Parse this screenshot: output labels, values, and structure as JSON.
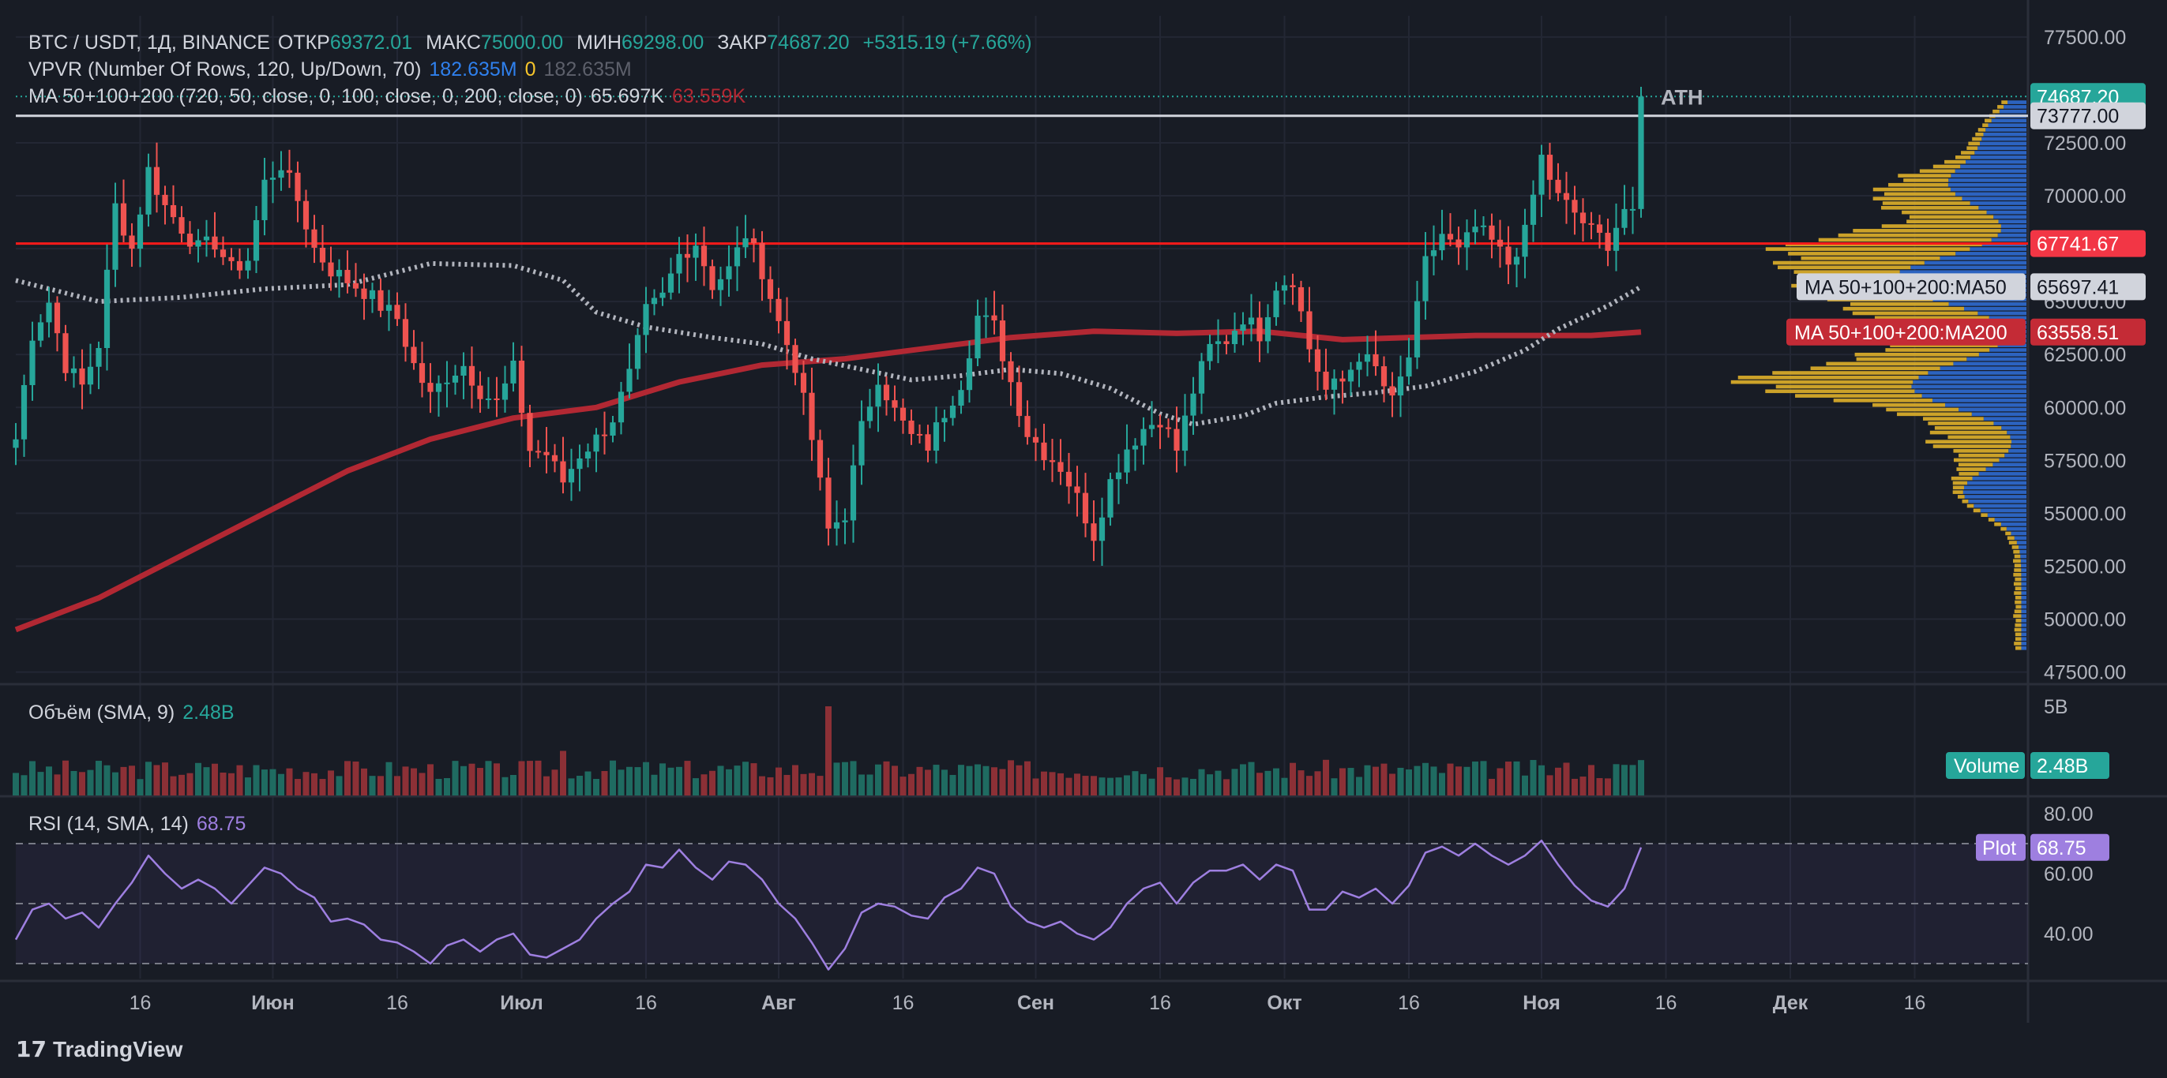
{
  "header": {
    "symbol": "BTC / USDT, 1Д, BINANCE",
    "open_label": "ОТКР",
    "open": "69372.01",
    "high_label": "МАКС",
    "high": "75000.00",
    "low_label": "МИН",
    "low": "69298.00",
    "close_label": "ЗАКР",
    "close": "74687.20",
    "change": "+5315.19 (+7.66%)"
  },
  "vpvr": {
    "label": "VPVR (Number Of Rows, 120, Up/Down, 70)",
    "up": "182.635M",
    "down": "0",
    "total": "182.635M"
  },
  "ma": {
    "label": "MA 50+100+200 (720, 50, close, 0, 100, close, 0, 200, close, 0)",
    "ma50": "65.697K",
    "ma200": "63.559K"
  },
  "volume_legend": {
    "label": "Объём (SMA, 9)",
    "value": "2.48B"
  },
  "rsi_legend": {
    "label": "RSI (14, SMA, 14)",
    "value": "68.75"
  },
  "colors": {
    "up": "#26a69a",
    "down": "#ef5350",
    "ma50": "#b2b5be",
    "ma200": "#b22833",
    "resistance": "#ff1a1a",
    "ath_line": "#d1d4dc",
    "rsi": "#9e7fe0",
    "vp_up": "#2f6bd1",
    "vp_down": "#e0b12a"
  },
  "branding": {
    "name": "TradingView"
  },
  "chart_data": [
    {
      "type": "candlestick",
      "title": "BTC / USDT, 1Д, BINANCE",
      "ylim": [
        47000,
        78500
      ],
      "y_ticks": [
        "77500.00",
        "72500.00",
        "70000.00",
        "67500.00",
        "65000.00",
        "62500.00",
        "60000.00",
        "57500.00",
        "55000.00",
        "52500.00",
        "50000.00",
        "47500.00"
      ],
      "x_ticks": [
        {
          "label": "16",
          "day": 15
        },
        {
          "label": "Июн",
          "day": 31
        },
        {
          "label": "16",
          "day": 46
        },
        {
          "label": "Июл",
          "day": 61
        },
        {
          "label": "16",
          "day": 76
        },
        {
          "label": "Авг",
          "day": 92
        },
        {
          "label": "16",
          "day": 107
        },
        {
          "label": "Сен",
          "day": 123
        },
        {
          "label": "16",
          "day": 138
        },
        {
          "label": "Окт",
          "day": 153
        },
        {
          "label": "16",
          "day": 168
        },
        {
          "label": "Ноя",
          "day": 184
        },
        {
          "label": "16",
          "day": 199
        },
        {
          "label": "Дек",
          "day": 214
        },
        {
          "label": "16",
          "day": 229
        }
      ],
      "close_points": [
        [
          0,
          58500
        ],
        [
          2,
          63500
        ],
        [
          4,
          65000
        ],
        [
          6,
          62000
        ],
        [
          8,
          61000
        ],
        [
          10,
          63000
        ],
        [
          12,
          69500
        ],
        [
          14,
          67500
        ],
        [
          16,
          71200
        ],
        [
          18,
          69500
        ],
        [
          20,
          68500
        ],
        [
          22,
          67500
        ],
        [
          24,
          67800
        ],
        [
          26,
          66500
        ],
        [
          28,
          67000
        ],
        [
          30,
          70600
        ],
        [
          32,
          71500
        ],
        [
          34,
          69800
        ],
        [
          36,
          67500
        ],
        [
          38,
          66500
        ],
        [
          40,
          66000
        ],
        [
          42,
          65500
        ],
        [
          44,
          64800
        ],
        [
          46,
          64200
        ],
        [
          48,
          62000
        ],
        [
          50,
          60500
        ],
        [
          52,
          61500
        ],
        [
          54,
          62000
        ],
        [
          56,
          60800
        ],
        [
          58,
          60200
        ],
        [
          60,
          61800
        ],
        [
          62,
          58000
        ],
        [
          64,
          57800
        ],
        [
          66,
          56500
        ],
        [
          68,
          57800
        ],
        [
          70,
          58500
        ],
        [
          72,
          59500
        ],
        [
          74,
          61500
        ],
        [
          76,
          64500
        ],
        [
          78,
          65200
        ],
        [
          80,
          67200
        ],
        [
          82,
          67800
        ],
        [
          84,
          65800
        ],
        [
          86,
          66500
        ],
        [
          88,
          68200
        ],
        [
          90,
          66500
        ],
        [
          92,
          64000
        ],
        [
          94,
          62000
        ],
        [
          96,
          58500
        ],
        [
          98,
          54200
        ],
        [
          100,
          55000
        ],
        [
          102,
          59000
        ],
        [
          104,
          61500
        ],
        [
          106,
          59800
        ],
        [
          108,
          58600
        ],
        [
          110,
          58200
        ],
        [
          112,
          59800
        ],
        [
          114,
          61200
        ],
        [
          116,
          64300
        ],
        [
          118,
          63800
        ],
        [
          120,
          61200
        ],
        [
          122,
          58800
        ],
        [
          124,
          57900
        ],
        [
          126,
          57200
        ],
        [
          128,
          55700
        ],
        [
          130,
          54000
        ],
        [
          132,
          56500
        ],
        [
          134,
          58100
        ],
        [
          136,
          59000
        ],
        [
          138,
          59500
        ],
        [
          140,
          58000
        ],
        [
          142,
          60800
        ],
        [
          144,
          62800
        ],
        [
          146,
          63200
        ],
        [
          148,
          64300
        ],
        [
          150,
          63500
        ],
        [
          152,
          65800
        ],
        [
          154,
          66100
        ],
        [
          156,
          62800
        ],
        [
          158,
          60800
        ],
        [
          160,
          61200
        ],
        [
          162,
          62500
        ],
        [
          164,
          61800
        ],
        [
          166,
          60200
        ],
        [
          168,
          62400
        ],
        [
          170,
          66800
        ],
        [
          172,
          68200
        ],
        [
          174,
          67300
        ],
        [
          176,
          68500
        ],
        [
          178,
          67800
        ],
        [
          180,
          66800
        ],
        [
          182,
          68200
        ],
        [
          184,
          71800
        ],
        [
          186,
          69900
        ],
        [
          188,
          69200
        ],
        [
          190,
          68300
        ],
        [
          192,
          67800
        ],
        [
          194,
          69400
        ],
        [
          196,
          74690
        ]
      ],
      "last_close": 74687.2,
      "resistance": 67741.67,
      "ath_level": 73777.0,
      "ath_label": "ATH",
      "ma50_points": [
        [
          0,
          66000
        ],
        [
          10,
          65000
        ],
        [
          20,
          65200
        ],
        [
          30,
          65600
        ],
        [
          40,
          65800
        ],
        [
          50,
          66800
        ],
        [
          60,
          66700
        ],
        [
          66,
          66000
        ],
        [
          70,
          64500
        ],
        [
          76,
          63800
        ],
        [
          84,
          63300
        ],
        [
          90,
          63000
        ],
        [
          96,
          62300
        ],
        [
          102,
          61800
        ],
        [
          108,
          61300
        ],
        [
          114,
          61500
        ],
        [
          120,
          61800
        ],
        [
          126,
          61600
        ],
        [
          132,
          60900
        ],
        [
          138,
          59700
        ],
        [
          142,
          59200
        ],
        [
          148,
          59600
        ],
        [
          152,
          60200
        ],
        [
          158,
          60500
        ],
        [
          164,
          60700
        ],
        [
          170,
          61000
        ],
        [
          176,
          61700
        ],
        [
          182,
          62700
        ],
        [
          186,
          63700
        ],
        [
          192,
          64800
        ],
        [
          196,
          65697.41
        ]
      ],
      "ma50_value": 65697.41,
      "ma50_label": "MA 50+100+200:MA50",
      "ma200_points": [
        [
          0,
          49500
        ],
        [
          10,
          51000
        ],
        [
          20,
          53000
        ],
        [
          30,
          55000
        ],
        [
          40,
          57000
        ],
        [
          50,
          58500
        ],
        [
          60,
          59500
        ],
        [
          70,
          60000
        ],
        [
          80,
          61200
        ],
        [
          90,
          62000
        ],
        [
          100,
          62300
        ],
        [
          110,
          62800
        ],
        [
          120,
          63300
        ],
        [
          130,
          63600
        ],
        [
          140,
          63500
        ],
        [
          150,
          63600
        ],
        [
          160,
          63200
        ],
        [
          168,
          63300
        ],
        [
          176,
          63400
        ],
        [
          184,
          63400
        ],
        [
          190,
          63400
        ],
        [
          196,
          63558.51
        ]
      ],
      "ma200_value": 63558.51,
      "ma200_label": "MA 50+100+200:MA200",
      "volume_profile": {
        "price_min": 48500,
        "price_max": 74500,
        "rows": 120,
        "peaks_up": [
          [
            66000,
            1.0
          ],
          [
            61000,
            0.85
          ],
          [
            56000,
            0.45
          ],
          [
            70500,
            0.55
          ],
          [
            73000,
            0.25
          ]
        ],
        "peaks_down": [
          [
            67500,
            1.0
          ],
          [
            61500,
            0.9
          ],
          [
            64500,
            0.6
          ],
          [
            58500,
            0.4
          ],
          [
            70000,
            0.35
          ]
        ]
      }
    },
    {
      "type": "bar",
      "title": "Объём (SMA, 9)",
      "last_value": "2.48B",
      "y_ticks": [
        "5B"
      ],
      "badge_label": "Volume",
      "badge_value": "2.48B",
      "spikes": [
        [
          66,
          2.5
        ],
        [
          98,
          5.0
        ],
        [
          58,
          1.8
        ]
      ]
    },
    {
      "type": "line",
      "title": "RSI (14, SMA, 14)",
      "ylim": [
        25,
        85
      ],
      "y_ticks": [
        "80.00",
        "60.00",
        "40.00"
      ],
      "bands": [
        30,
        50,
        70
      ],
      "points": [
        [
          0,
          38
        ],
        [
          2,
          48
        ],
        [
          4,
          50
        ],
        [
          6,
          45
        ],
        [
          8,
          47
        ],
        [
          10,
          42
        ],
        [
          12,
          50
        ],
        [
          14,
          57
        ],
        [
          16,
          66
        ],
        [
          18,
          60
        ],
        [
          20,
          55
        ],
        [
          22,
          58
        ],
        [
          24,
          55
        ],
        [
          26,
          50
        ],
        [
          28,
          56
        ],
        [
          30,
          62
        ],
        [
          32,
          60
        ],
        [
          34,
          55
        ],
        [
          36,
          52
        ],
        [
          38,
          44
        ],
        [
          40,
          45
        ],
        [
          42,
          43
        ],
        [
          44,
          38
        ],
        [
          46,
          37
        ],
        [
          48,
          34
        ],
        [
          50,
          30
        ],
        [
          52,
          36
        ],
        [
          54,
          38
        ],
        [
          56,
          34
        ],
        [
          58,
          38
        ],
        [
          60,
          40
        ],
        [
          62,
          33
        ],
        [
          64,
          32
        ],
        [
          66,
          35
        ],
        [
          68,
          38
        ],
        [
          70,
          45
        ],
        [
          72,
          50
        ],
        [
          74,
          54
        ],
        [
          76,
          63
        ],
        [
          78,
          62
        ],
        [
          80,
          68
        ],
        [
          82,
          62
        ],
        [
          84,
          58
        ],
        [
          86,
          64
        ],
        [
          88,
          63
        ],
        [
          90,
          58
        ],
        [
          92,
          50
        ],
        [
          94,
          45
        ],
        [
          96,
          37
        ],
        [
          98,
          28
        ],
        [
          100,
          35
        ],
        [
          102,
          47
        ],
        [
          104,
          50
        ],
        [
          106,
          49
        ],
        [
          108,
          46
        ],
        [
          110,
          45
        ],
        [
          112,
          52
        ],
        [
          114,
          55
        ],
        [
          116,
          62
        ],
        [
          118,
          60
        ],
        [
          120,
          49
        ],
        [
          122,
          44
        ],
        [
          124,
          42
        ],
        [
          126,
          44
        ],
        [
          128,
          40
        ],
        [
          130,
          38
        ],
        [
          132,
          42
        ],
        [
          134,
          50
        ],
        [
          136,
          55
        ],
        [
          138,
          57
        ],
        [
          140,
          50
        ],
        [
          142,
          57
        ],
        [
          144,
          61
        ],
        [
          146,
          61
        ],
        [
          148,
          63
        ],
        [
          150,
          58
        ],
        [
          152,
          63
        ],
        [
          154,
          61
        ],
        [
          156,
          48
        ],
        [
          158,
          48
        ],
        [
          160,
          54
        ],
        [
          162,
          52
        ],
        [
          164,
          55
        ],
        [
          166,
          50
        ],
        [
          168,
          56
        ],
        [
          170,
          67
        ],
        [
          172,
          69
        ],
        [
          174,
          66
        ],
        [
          176,
          70
        ],
        [
          178,
          66
        ],
        [
          180,
          63
        ],
        [
          182,
          66
        ],
        [
          184,
          71
        ],
        [
          186,
          63
        ],
        [
          188,
          56
        ],
        [
          190,
          51
        ],
        [
          192,
          49
        ],
        [
          194,
          55
        ],
        [
          196,
          68.75
        ]
      ],
      "badge_label": "Plot",
      "badge_value": "68.75"
    }
  ]
}
